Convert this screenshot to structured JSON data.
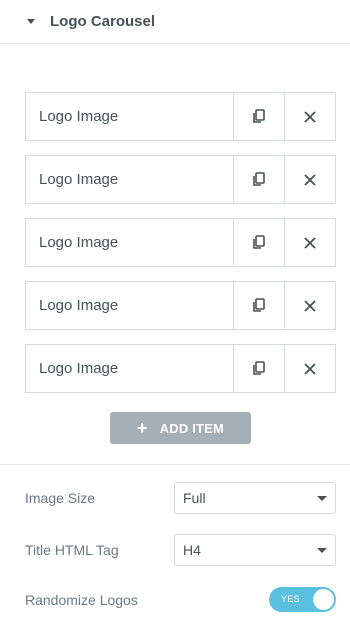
{
  "section": {
    "title": "Logo Carousel",
    "caret_icon": "caret-down-icon"
  },
  "repeater": {
    "items": [
      {
        "label": "Logo Image"
      },
      {
        "label": "Logo Image"
      },
      {
        "label": "Logo Image"
      },
      {
        "label": "Logo Image"
      },
      {
        "label": "Logo Image"
      }
    ],
    "duplicate_icon": "duplicate-icon",
    "remove_icon": "close-icon",
    "add_label": "ADD ITEM",
    "add_icon": "plus-icon"
  },
  "controls": {
    "image_size": {
      "label": "Image Size",
      "value": "Full"
    },
    "title_tag": {
      "label": "Title HTML Tag",
      "value": "H4"
    },
    "randomize": {
      "label": "Randomize Logos",
      "state_label": "YES",
      "on": true
    }
  },
  "colors": {
    "text_dark": "#495157",
    "text_label": "#6d7882",
    "border": "#d5dadf",
    "button_gray": "#a4afb7",
    "switch_on": "#5bc0de"
  }
}
